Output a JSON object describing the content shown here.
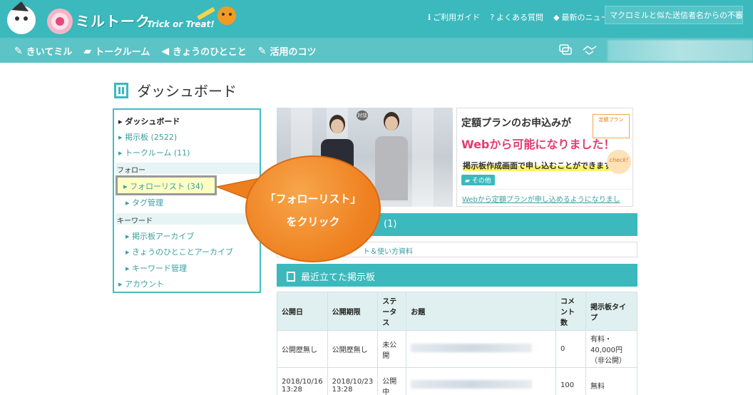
{
  "header": {
    "logo_text": "ミルトーク",
    "logo_sub": "Trick or Treat!",
    "links": [
      {
        "icon": "info-icon",
        "glyph": "ℹ",
        "label": "ご利用ガイド"
      },
      {
        "icon": "question-icon",
        "glyph": "?",
        "label": "よくある質問"
      },
      {
        "icon": "megaphone-icon",
        "glyph": "◆",
        "label": "最新のニュース"
      }
    ],
    "notice": "マクロミルと似た送信者名からの不審なメ…"
  },
  "nav": {
    "items": [
      {
        "icon": "kiitemiru-icon",
        "glyph": "✎",
        "label": "きいてミル"
      },
      {
        "icon": "talkroom-icon",
        "glyph": "▰",
        "label": "トークルーム"
      },
      {
        "icon": "megaphone-icon",
        "glyph": "◀",
        "label": "きょうのひとこと"
      },
      {
        "icon": "pencil-icon",
        "glyph": "✎",
        "label": "活用のコツ"
      }
    ]
  },
  "page": {
    "title": "ダッシュボード"
  },
  "sidebar": {
    "dashboard": "ダッシュボード",
    "board": "掲示板 (2522)",
    "talkroom": "トークルーム (11)",
    "follow_section": "フォロー",
    "follow_list": "フォローリスト (34)",
    "tag_manage": "タグ管理",
    "keyword_section": "キーワード",
    "board_archive": "掲示板アーカイブ",
    "hitokoto_archive": "きょうのひとことアーカイブ",
    "keyword_manage": "キーワード管理",
    "account": "アカウント"
  },
  "banner_photo": {
    "sign": "対談"
  },
  "banner_ad": {
    "line1": "定額プランのお申込みが",
    "line2": "Webから可能になりました！",
    "line3": "掲示板作成画面で申し込むことができます",
    "tag": "定額プラン",
    "category": "その他",
    "check": "check!",
    "footer": "Webから定額プランが申し込めるようになりました！"
  },
  "panels": {
    "notice_count": "(1)",
    "notice_row": "ト＆使い方資料",
    "recent_title": "最近立てた掲示板"
  },
  "table": {
    "headers": [
      "公開日",
      "公開期限",
      "ステータス",
      "お題",
      "コメント数",
      "掲示板タイプ"
    ],
    "rows": [
      {
        "open": "公開歴無し",
        "limit": "公開歴無し",
        "status": "未公開",
        "comments": "0",
        "type": "有料・40,000円（非公開）"
      },
      {
        "open": "2018/10/16 13:28",
        "limit": "2018/10/23 13:28",
        "status": "公開中",
        "comments": "100",
        "type": "無料"
      }
    ]
  },
  "callout": {
    "line1": "「フォローリスト」",
    "line2": "をクリック"
  }
}
